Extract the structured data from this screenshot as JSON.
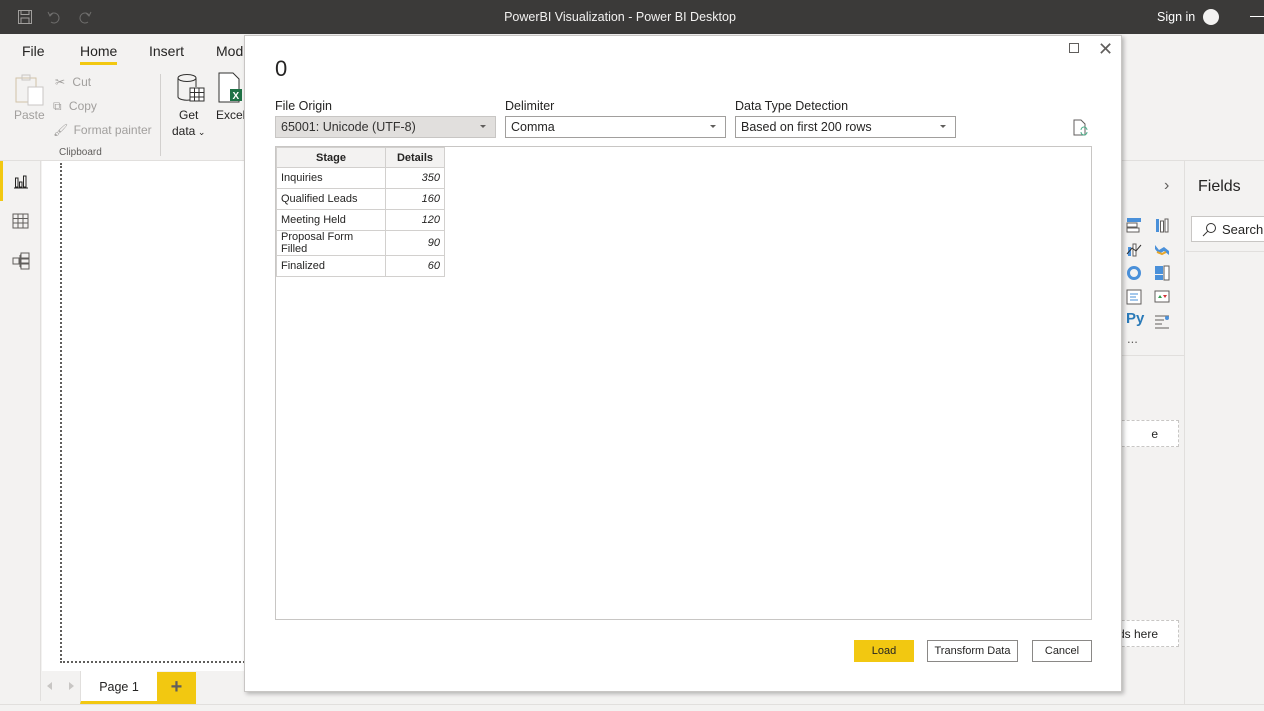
{
  "window": {
    "title": "PowerBI Visualization - Power BI Desktop",
    "sign_in": "Sign in"
  },
  "ribbon": {
    "tabs": [
      {
        "label": "File",
        "active": false
      },
      {
        "label": "Home",
        "active": true
      },
      {
        "label": "Insert",
        "active": false
      },
      {
        "label": "Mod",
        "active": false
      }
    ],
    "clipboard": {
      "paste": "Paste",
      "cut": "Cut",
      "copy": "Copy",
      "format_painter": "Format painter",
      "group_label": "Clipboard"
    },
    "data": {
      "get_data_line1": "Get",
      "get_data_line2": "data",
      "excel": "Excel"
    }
  },
  "leftnav": {
    "items": [
      {
        "name": "report-view",
        "icon": "bar-chart-icon",
        "active": true
      },
      {
        "name": "data-view",
        "icon": "table-icon",
        "active": false
      },
      {
        "name": "model-view",
        "icon": "model-icon",
        "active": false
      }
    ]
  },
  "pages": {
    "tabs": [
      {
        "label": "Page 1",
        "active": true
      }
    ],
    "add_label": "+"
  },
  "fields_pane": {
    "title": "Fields",
    "search_placeholder": "Search"
  },
  "viz_pane": {
    "drop_wells": [
      "e",
      "elds here"
    ],
    "more": "..."
  },
  "dialog": {
    "title": "0",
    "file_origin": {
      "label": "File Origin",
      "value": "65001: Unicode (UTF-8)"
    },
    "delimiter": {
      "label": "Delimiter",
      "value": "Comma"
    },
    "data_type_detection": {
      "label": "Data Type Detection",
      "value": "Based on first 200 rows"
    },
    "table": {
      "columns": [
        "Stage",
        "Details"
      ],
      "rows": [
        [
          "Inquiries",
          "350"
        ],
        [
          "Qualified Leads",
          "160"
        ],
        [
          "Meeting Held",
          "120"
        ],
        [
          "Proposal Form Filled",
          "90"
        ],
        [
          "Finalized",
          "60"
        ]
      ]
    },
    "buttons": {
      "load": "Load",
      "transform": "Transform Data",
      "cancel": "Cancel"
    }
  },
  "colors": {
    "accent": "#f2c811",
    "titlebar": "#3b3a39"
  }
}
